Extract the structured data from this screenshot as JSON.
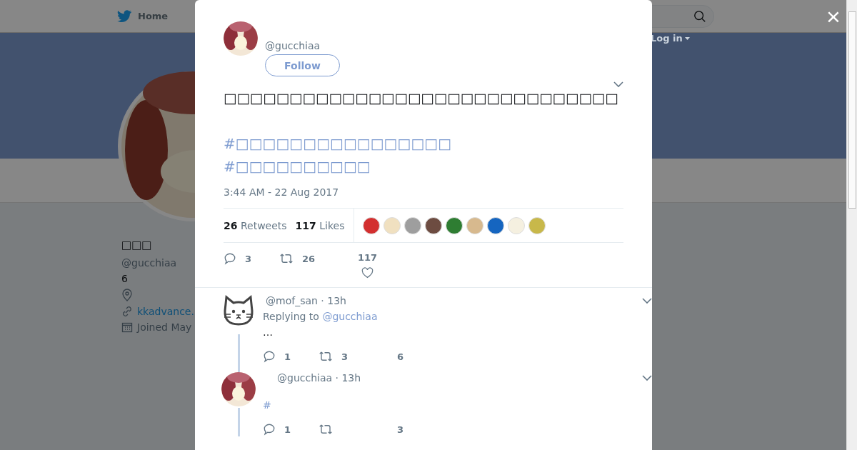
{
  "background_page": {
    "nav": {
      "home": "Home",
      "login": "Log in"
    },
    "profile": {
      "name": "□□□",
      "handle": "@gucchiaa",
      "bio": "6",
      "link": "kkadvance.",
      "joined": "Joined May"
    }
  },
  "close_button": "×",
  "tweet": {
    "handle": "@gucchiaa",
    "follow": "Follow",
    "text": "□□□□□□□□□□□□□□□□□□□□□□□□□□□□□□",
    "hashtags": [
      "#□□□□□□□□□□□□□□□□",
      "#□□□□□□□□□□"
    ],
    "timestamp": "3:44 AM - 22 Aug 2017",
    "stats": [
      {
        "count": "26",
        "label": "Retweets"
      },
      {
        "count": "117",
        "label": "Likes"
      }
    ],
    "actions": {
      "replies": "3",
      "retweets": "26",
      "likes": "117"
    }
  },
  "replies": [
    {
      "kind": "cat",
      "handle": "@mof_san",
      "time": "· 13h",
      "replying_label": "Replying to",
      "replying_to": "@gucchiaa",
      "text": "…",
      "replies": "1",
      "retweets": "3",
      "likes": "6"
    },
    {
      "handle": "@gucchiaa",
      "time": "· 13h",
      "text": "#",
      "replies": "1",
      "likes": "3"
    }
  ]
}
